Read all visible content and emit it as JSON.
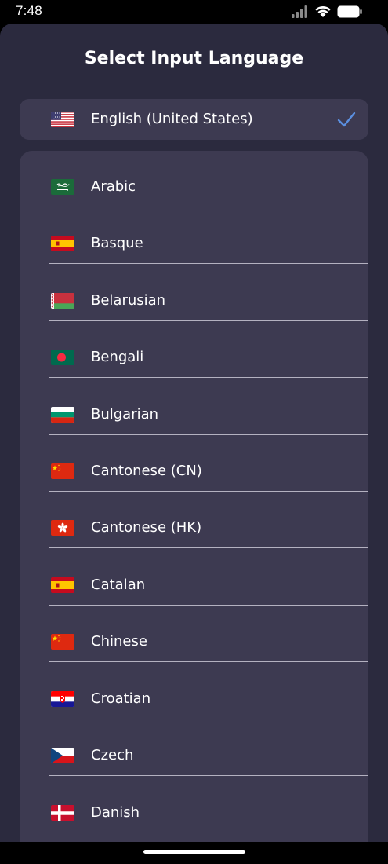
{
  "status_bar": {
    "time": "7:48"
  },
  "title": "Select Input Language",
  "selected": {
    "label": "English (United States)",
    "flag": "us-flag-icon",
    "check": "checkmark-icon"
  },
  "languages": [
    {
      "label": "Arabic",
      "flag": "saudi-arabia-flag-icon"
    },
    {
      "label": "Basque",
      "flag": "spain-flag-icon"
    },
    {
      "label": "Belarusian",
      "flag": "belarus-flag-icon"
    },
    {
      "label": "Bengali",
      "flag": "bangladesh-flag-icon"
    },
    {
      "label": "Bulgarian",
      "flag": "bulgaria-flag-icon"
    },
    {
      "label": "Cantonese (CN)",
      "flag": "china-flag-icon"
    },
    {
      "label": "Cantonese (HK)",
      "flag": "hong-kong-flag-icon"
    },
    {
      "label": "Catalan",
      "flag": "spain-flag-icon"
    },
    {
      "label": "Chinese",
      "flag": "china-flag-icon"
    },
    {
      "label": "Croatian",
      "flag": "croatia-flag-icon"
    },
    {
      "label": "Czech",
      "flag": "czech-flag-icon"
    },
    {
      "label": "Danish",
      "flag": "denmark-flag-icon"
    }
  ],
  "colors": {
    "sheet_bg": "#2b2a3e",
    "card_bg": "#3d3a51",
    "accent_check": "#5b8fe0"
  }
}
